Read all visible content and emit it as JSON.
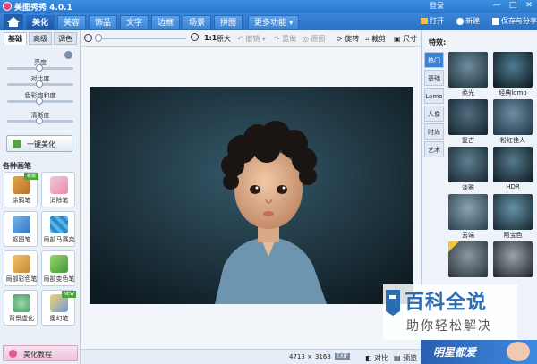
{
  "titlebar": {
    "title": "美图秀秀 4.0.1",
    "login": "登录",
    "controls": [
      "—",
      "□",
      "✕"
    ]
  },
  "menu": {
    "tabs": [
      "美化",
      "美容",
      "饰品",
      "文字",
      "边框",
      "场景",
      "拼图"
    ],
    "more": "更多功能 ▾",
    "open": "打开",
    "new": "新建",
    "save_share": "保存与分享"
  },
  "toolbar": {
    "ratio": "1:1",
    "original": "原大",
    "undo": "撤销",
    "redo": "重做",
    "original_image": "原图",
    "rotate": "旋转",
    "crop": "裁剪",
    "size": "尺寸"
  },
  "leftpanel": {
    "subtabs": [
      "基础",
      "高级",
      "调色"
    ],
    "sliders": [
      {
        "label": "亮度",
        "value": 0.5
      },
      {
        "label": "对比度",
        "value": 0.5
      },
      {
        "label": "色彩饱和度",
        "value": 0.5
      },
      {
        "label": "清晰度",
        "value": 0.5
      }
    ],
    "one_click": "一键美化",
    "brush_header": "各种画笔",
    "tools": [
      {
        "label": "涂鸦笔",
        "badge": "新版"
      },
      {
        "label": "消除笔",
        "badge": ""
      },
      {
        "label": "抠图笔",
        "badge": ""
      },
      {
        "label": "局部马赛克",
        "badge": ""
      },
      {
        "label": "局部彩色笔",
        "badge": ""
      },
      {
        "label": "局部变色笔",
        "badge": ""
      },
      {
        "label": "背景虚化",
        "badge": ""
      },
      {
        "label": "魔幻笔",
        "badge": "NEW"
      }
    ],
    "tutorial": "美化教程"
  },
  "statusbar": {
    "width": "4713",
    "times": "×",
    "height": "3168",
    "exif": "EXIF",
    "compare": "对比",
    "preview": "预览"
  },
  "rightpanel": {
    "header": "特效:",
    "categories": [
      "热门",
      "基础",
      "Lomo",
      "人像",
      "时尚",
      "艺术"
    ],
    "effects": [
      "柔光",
      "经典lomo",
      "复古",
      "粉红佳人",
      "淡雅",
      "HDR",
      "云端",
      "阿宝色",
      "",
      ""
    ]
  },
  "watermark": {
    "title": "百科全说",
    "subtitle": "助你轻松解决"
  },
  "banner": {
    "text": "明星都爱"
  },
  "colors": {
    "title_blue": "#2a78cf",
    "menu_blue": "#2b70c4",
    "active_cat": "#3b82d6"
  }
}
